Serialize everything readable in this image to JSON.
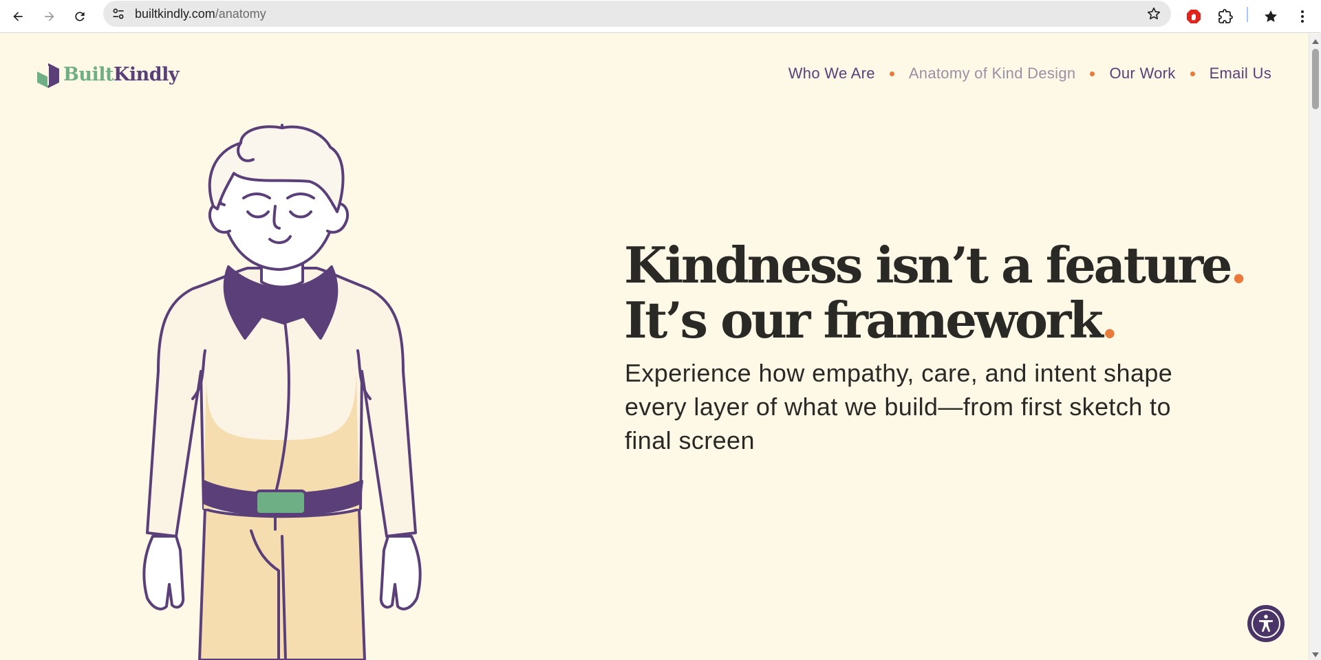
{
  "browser": {
    "url_domain": "builtkindly.com",
    "url_path": "/anatomy",
    "icons": [
      "back-arrow-icon",
      "forward-arrow-icon",
      "reload-icon",
      "site-settings-icon",
      "bookmark-star-icon",
      "adblock-extension-icon",
      "extensions-puzzle-icon",
      "bookmarks-star-icon",
      "more-menu-icon"
    ]
  },
  "site": {
    "logo_part1": "Built",
    "logo_part2": "Kindly",
    "nav": [
      {
        "label": "Who We Are",
        "active": false
      },
      {
        "label": "Anatomy of Kind Design",
        "active": true
      },
      {
        "label": "Our Work",
        "active": false
      },
      {
        "label": "Email Us",
        "active": false
      }
    ]
  },
  "hero": {
    "title_line1": "Kindness isn’t a feature",
    "title_line2": "It’s our framework",
    "title_dot": ".",
    "subtitle": "Experience how empathy, care, and intent shape every layer of what we build—from first sketch to final screen"
  },
  "colors": {
    "background": "#fdf9e6",
    "purple": "#5a3f78",
    "green": "#6eaf86",
    "accent_orange": "#ea7a3c",
    "text": "#2b2926",
    "nav_active": "#9a90a4"
  },
  "widgets": {
    "accessibility_button_icon": "accessibility-person-icon"
  }
}
